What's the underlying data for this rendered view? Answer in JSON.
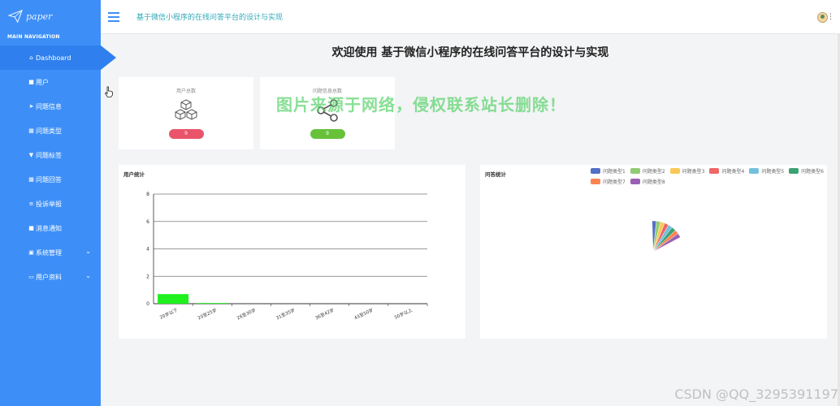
{
  "sidebar": {
    "logo_text": "paper",
    "nav_caption": "MAIN NAVIGATION",
    "items": [
      {
        "label": "Dashboard",
        "icon": "home-icon",
        "glyph": "⌂",
        "active": true
      },
      {
        "label": "用户",
        "icon": "user-icon",
        "glyph": "■"
      },
      {
        "label": "问题信息",
        "icon": "send-icon",
        "glyph": "➤"
      },
      {
        "label": "问题类型",
        "icon": "grid-icon",
        "glyph": "▦"
      },
      {
        "label": "问题标签",
        "icon": "tag-icon",
        "glyph": "▼"
      },
      {
        "label": "问题回答",
        "icon": "grid-icon",
        "glyph": "▦"
      },
      {
        "label": "投诉举报",
        "icon": "list-icon",
        "glyph": "≡"
      },
      {
        "label": "消息通知",
        "icon": "message-icon",
        "glyph": "■"
      },
      {
        "label": "系统管理",
        "icon": "lock-icon",
        "glyph": "▣",
        "expandable": true
      },
      {
        "label": "用户资料",
        "icon": "id-card-icon",
        "glyph": "▭",
        "expandable": true
      }
    ]
  },
  "header": {
    "title": "基于微信小程序的在线问答平台的设计与实现"
  },
  "main": {
    "welcome": "欢迎使用 基于微信小程序的在线问答平台的设计与实现",
    "cards": [
      {
        "label": "用户总数",
        "value": "9",
        "icon": "cubes-icon",
        "badge_color": "#e9546b"
      },
      {
        "label": "问题信息总数",
        "value": "9",
        "icon": "share-icon",
        "badge_color": "#67c23a"
      }
    ],
    "watermark": "图片来源于网络，侵权联系站长删除！",
    "footer_watermark": "CSDN @QQ_3295391197"
  },
  "panels": {
    "user_title": "用户统计",
    "qa_title": "问答统计"
  },
  "chart_data": [
    {
      "type": "bar",
      "title": "用户统计",
      "categories": [
        "20岁以下",
        "20至25岁",
        "26至30岁",
        "31至35岁",
        "36至42岁",
        "43至50岁",
        "50岁以上"
      ],
      "values": [
        0.7,
        0.05,
        0,
        0,
        0,
        0,
        0
      ],
      "ylim": [
        0,
        8
      ],
      "yticks": [
        "0",
        "2",
        "4",
        "6",
        "8"
      ],
      "grid": true,
      "bar_color": "#1ef11e"
    },
    {
      "type": "pie",
      "title": "问答统计",
      "legend_position": "top",
      "series": [
        {
          "name": "问题类型1",
          "color": "#5470c6",
          "value": 1
        },
        {
          "name": "问题类型2",
          "color": "#91cc75",
          "value": 1
        },
        {
          "name": "问题类型3",
          "color": "#fac858",
          "value": 1
        },
        {
          "name": "问题类型4",
          "color": "#ee6666",
          "value": 1
        },
        {
          "name": "问题类型5",
          "color": "#73c0de",
          "value": 1
        },
        {
          "name": "问题类型6",
          "color": "#3ba272",
          "value": 1
        },
        {
          "name": "问题类型7",
          "color": "#fc8452",
          "value": 1
        },
        {
          "name": "问题类型8",
          "color": "#9a60b4",
          "value": 1
        }
      ]
    }
  ]
}
